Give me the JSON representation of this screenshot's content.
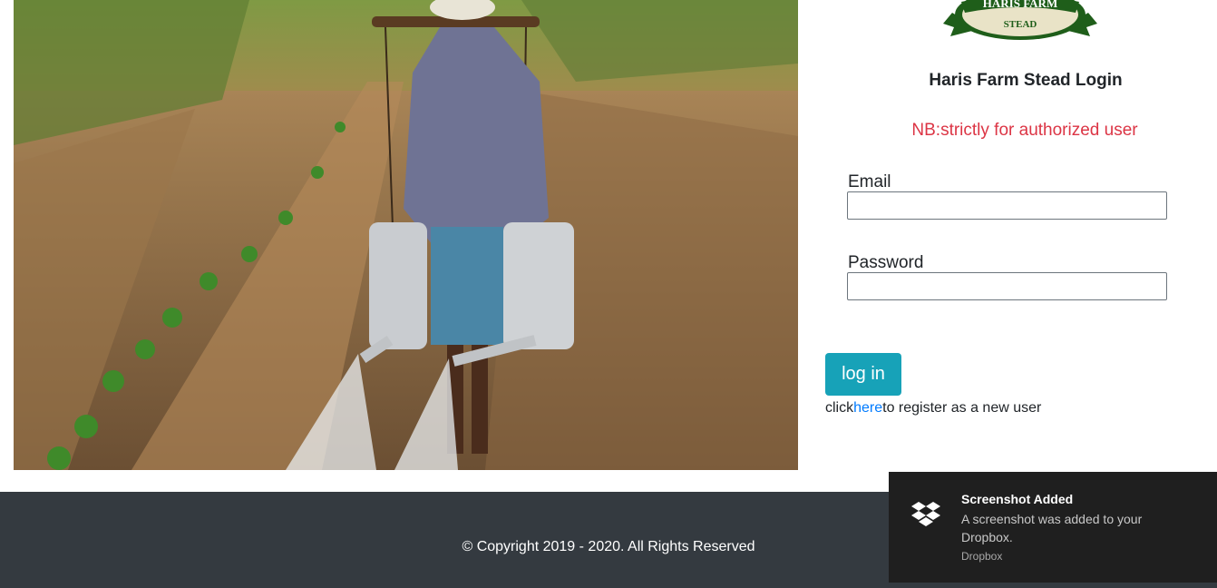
{
  "brand": {
    "logo_text_top": "HARIS FARM",
    "logo_text_bottom": "STEAD"
  },
  "login": {
    "title": "Haris Farm Stead Login",
    "note": "NB:strictly for authorized user",
    "email_label": "Email",
    "email_value": "",
    "password_label": "Password",
    "password_value": "",
    "submit_label": "log in",
    "register_prefix": "click",
    "register_link": "here",
    "register_suffix": "to register as a new user"
  },
  "footer": {
    "copyright": "© Copyright 2019 - 2020. All Rights Reserved"
  },
  "notification": {
    "icon": "dropbox-icon",
    "title": "Screenshot Added",
    "body": "A screenshot was added to your Dropbox.",
    "source": "Dropbox"
  },
  "colors": {
    "accent": "#17a2b8",
    "warning_text": "#dc3545",
    "link": "#007bff",
    "footer_bg": "#343a40",
    "toast_bg": "#1f1f1f",
    "logo_green": "#1f5e1a"
  }
}
